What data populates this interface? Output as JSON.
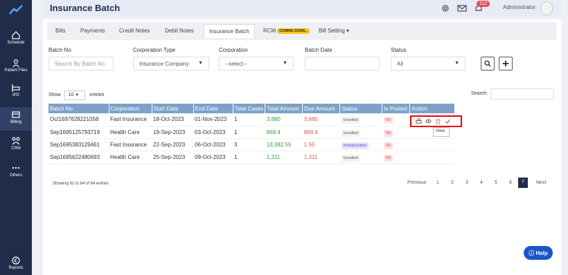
{
  "sidebar": {
    "items": [
      {
        "label": "Schedule",
        "icon": "home-icon"
      },
      {
        "label": "Patient Files",
        "icon": "user-icon"
      },
      {
        "label": "IPD",
        "icon": "bed-icon"
      },
      {
        "label": "Billing",
        "icon": "billing-icon"
      },
      {
        "label": "CRM",
        "icon": "crm-icon"
      },
      {
        "label": "Others",
        "icon": "more-icon"
      },
      {
        "label": "Reports",
        "icon": "reports-icon"
      }
    ]
  },
  "header": {
    "title": "Insurance Batch",
    "notification_count": "112",
    "user": "Administrator"
  },
  "tabs": [
    "Bills",
    "Payments",
    "Credit Notes",
    "Debit Notes",
    "Insurance Batch",
    "RCM",
    "Bill Setting ▾"
  ],
  "coming_soon": "COMING SOON...",
  "filters": {
    "batch_no_label": "Batch No",
    "batch_no_placeholder": "Search By Batch No",
    "corp_type_label": "Corporation Type",
    "corp_type_value": "Insurance Company",
    "corp_label": "Corporation",
    "corp_value": "--select--",
    "batch_date_label": "Batch Date",
    "status_label": "Status",
    "status_value": "All"
  },
  "table_controls": {
    "show_label": "Show",
    "entries_value": "10",
    "entries_label": "entries",
    "search_label": "Search:"
  },
  "columns": [
    "Batch No",
    "Corporation",
    "Start Date",
    "End Date",
    "Total Cases",
    "Total Amount",
    "Due Amount",
    "Status",
    "Is Posted",
    "Action"
  ],
  "rows": [
    {
      "batch": "Oct1697628221058",
      "corp": "Fast Insurance",
      "start": "18-Oct-2023",
      "end": "01-Nov-2023",
      "cases": "1",
      "total": "3,680",
      "due": "3,680",
      "status": "Unsettled",
      "posted": "No"
    },
    {
      "batch": "Sep1695125793719",
      "corp": "Health Care",
      "start": "19-Sep-2023",
      "end": "03-Oct-2023",
      "cases": "1",
      "total": "869.4",
      "due": "869.4",
      "status": "Unsettled",
      "posted": "No"
    },
    {
      "batch": "Sep1695383129461",
      "corp": "Fast Insurance",
      "start": "22-Sep-2023",
      "end": "06-Oct-2023",
      "cases": "3",
      "total": "13,382.55",
      "due": "1.55",
      "status": "PartiallySettled",
      "posted": "No"
    },
    {
      "batch": "Sep1695622480693",
      "corp": "Health Care",
      "start": "25-Sep-2023",
      "end": "09-Oct-2023",
      "cases": "1",
      "total": "1,311",
      "due": "1,311",
      "status": "Unsettled",
      "posted": "No"
    }
  ],
  "tooltip": "View",
  "footer": {
    "showing": "Showing 61 to 64 of 64 entries",
    "previous": "Previous",
    "pages": [
      "1",
      "2",
      "3",
      "4",
      "5",
      "6",
      "7"
    ],
    "active_page": "7",
    "next": "Next"
  },
  "help_label": "Help",
  "colors": {
    "sidebar": "#1f2d4a",
    "table_header": "#7ea1c9",
    "amount_green": "#2e9e3e",
    "amount_red": "#d9534f",
    "highlight": "#e00000",
    "help": "#1a57c6"
  }
}
